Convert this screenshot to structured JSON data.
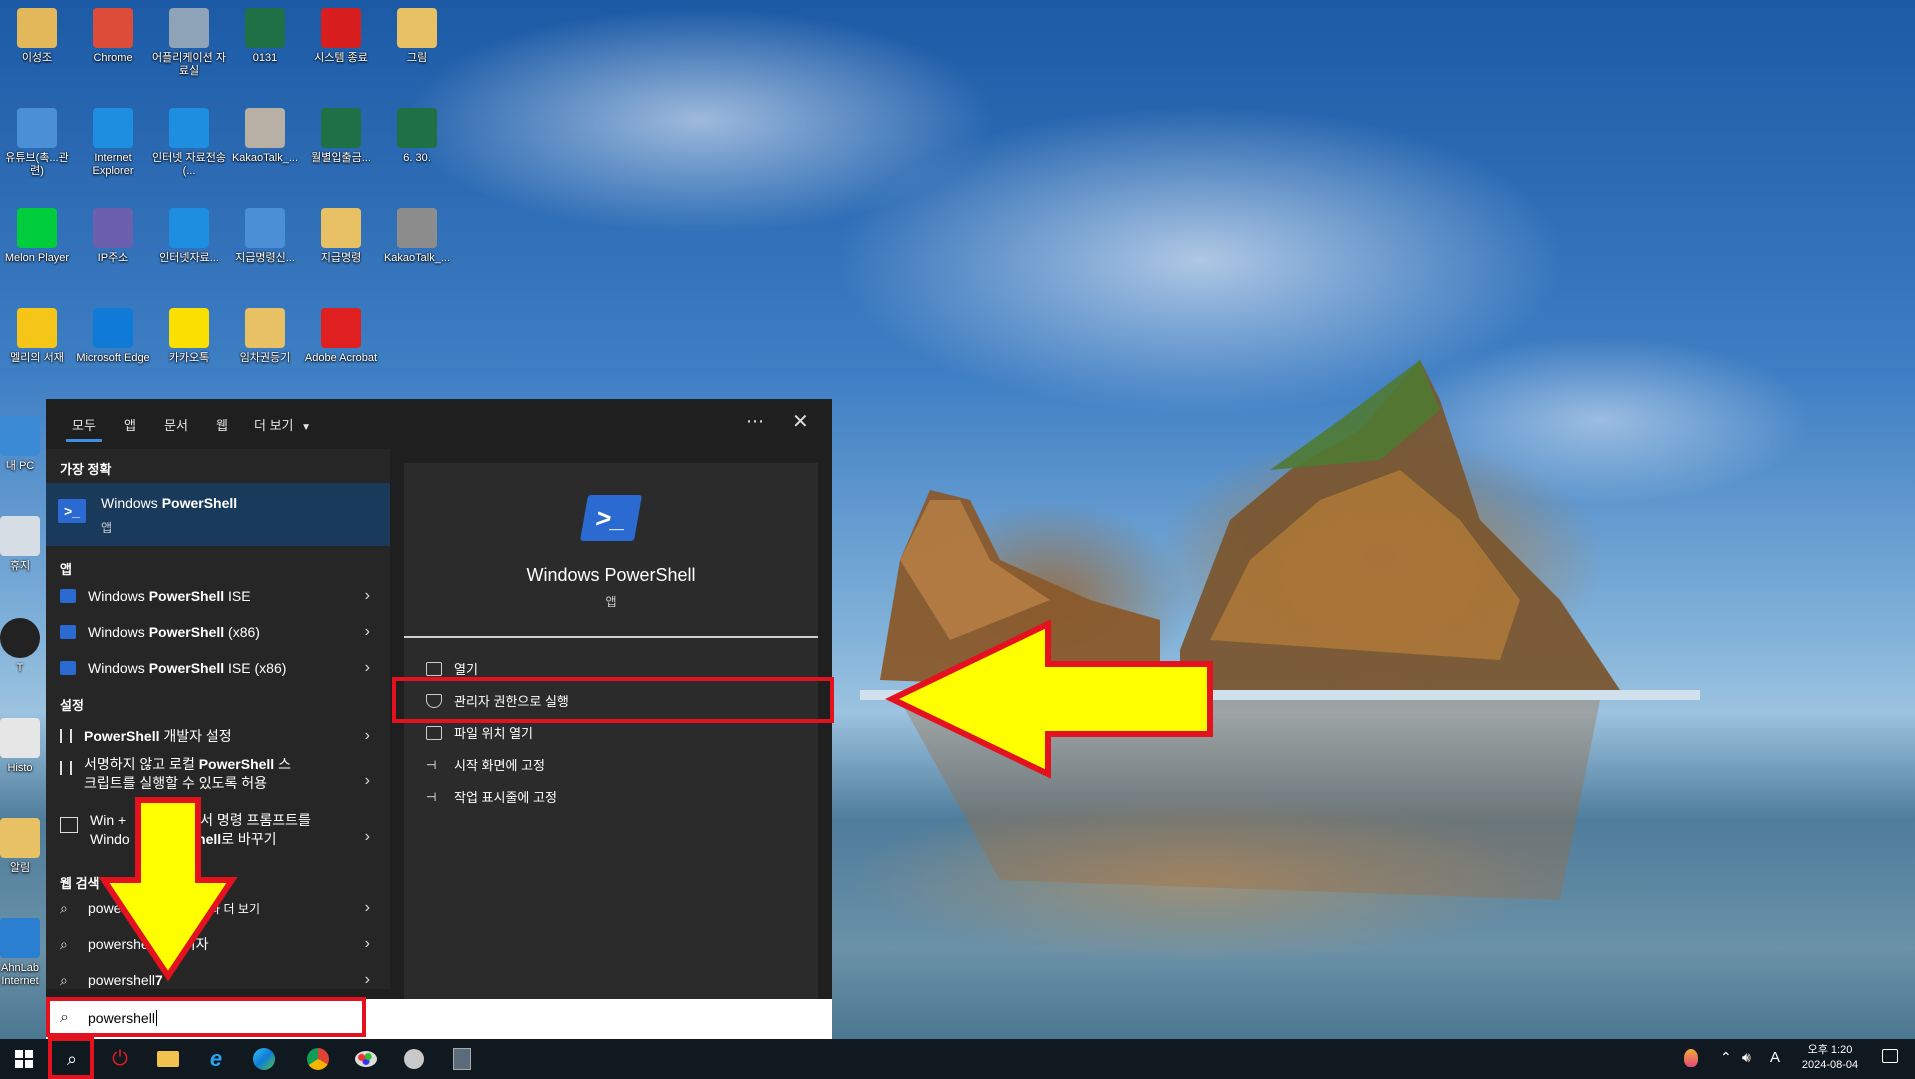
{
  "desktop_icons": [
    {
      "label": "이성조",
      "icon": "user-folder-icon",
      "color": "#e2b85a"
    },
    {
      "label": "Chrome",
      "icon": "chrome-icon",
      "color": "#dd4b39"
    },
    {
      "label": "어플리케이션 자료실",
      "icon": "apps-folder-icon",
      "color": "#8fa3b8"
    },
    {
      "label": "0131",
      "icon": "excel-icon",
      "color": "#1e7145"
    },
    {
      "label": "시스템 종료",
      "icon": "power-icon",
      "color": "#d81e1e"
    },
    {
      "label": "그림",
      "icon": "folder-icon",
      "color": "#e8c164"
    },
    {
      "label": "유튜브(촉...관련)",
      "icon": "hwp-doc-icon",
      "color": "#4b8fd6"
    },
    {
      "label": "Internet Explorer",
      "icon": "ie-icon",
      "color": "#1d8ee0"
    },
    {
      "label": "인터넷 자료전송(...",
      "icon": "ie-transfer-icon",
      "color": "#1d8ee0"
    },
    {
      "label": "KakaoTalk_...",
      "icon": "image-icon",
      "color": "#b9b0a5"
    },
    {
      "label": "월별입출금...",
      "icon": "excel-icon",
      "color": "#1e7145"
    },
    {
      "label": "6. 30.",
      "icon": "excel-icon",
      "color": "#1e7145"
    },
    {
      "label": "Melon Player",
      "icon": "melon-icon",
      "color": "#00cd3c"
    },
    {
      "label": "IP주소",
      "icon": "network-icon",
      "color": "#6b5fae"
    },
    {
      "label": "인터넷자료...",
      "icon": "ie-folder-icon",
      "color": "#1d8ee0"
    },
    {
      "label": "지급명령신...",
      "icon": "hwp-doc-icon",
      "color": "#4b8fd6"
    },
    {
      "label": "지급명령",
      "icon": "folder-doc-icon",
      "color": "#e8c164"
    },
    {
      "label": "KakaoTalk_...",
      "icon": "image-icon",
      "color": "#8d8d8d"
    },
    {
      "label": "멜리의 서재",
      "icon": "millie-icon",
      "color": "#f5c518"
    },
    {
      "label": "Microsoft Edge",
      "icon": "edge-icon",
      "color": "#0f7bd6"
    },
    {
      "label": "카카오톡",
      "icon": "kakaotalk-icon",
      "color": "#f9e000"
    },
    {
      "label": "임차권등기",
      "icon": "pdf-folder-icon",
      "color": "#e8c164"
    },
    {
      "label": "Adobe Acrobat",
      "icon": "acrobat-icon",
      "color": "#e02020"
    }
  ],
  "left_edge_labels": [
    "내 PC",
    "휴지",
    "T",
    "Histo",
    "알림",
    "AhnLab Internet"
  ],
  "search_panel": {
    "tabs": [
      "모두",
      "앱",
      "문서",
      "웹",
      "더 보기"
    ],
    "more_icon": "ellipsis-icon",
    "close_icon": "close-icon",
    "best_match_header": "가장 정확",
    "best_match": {
      "name_prefix": "Windows ",
      "name_bold": "PowerShell",
      "type": "앱"
    },
    "apps_header": "앱",
    "apps": [
      {
        "prefix": "Windows ",
        "bold": "PowerShell",
        "suffix": " ISE"
      },
      {
        "prefix": "Windows ",
        "bold": "PowerShell",
        "suffix": " (x86)"
      },
      {
        "prefix": "Windows ",
        "bold": "PowerShell",
        "suffix": " ISE (x86)"
      }
    ],
    "settings_header": "설정",
    "settings": [
      {
        "line1_bold": "PowerShell",
        "line1": " 개발자 설정",
        "line2": ""
      },
      {
        "line1": "서명하지 않고 로컬 ",
        "line1_bold": "PowerShell",
        "line1_after": " 스",
        "line2": "크립트를 실행할 수 있도록 허용"
      },
      {
        "line1": "Win + ",
        "line1_after": "서 명령 프롬프트를",
        "line2": "Windo",
        "line2_bold": "Shell",
        "line2_after": "로 바꾸기"
      }
    ],
    "web_header": "웹 검색",
    "web": [
      {
        "text": "power",
        "suffix": "결과 더 보기"
      },
      {
        "text": "powershe",
        "suffix": "리자"
      },
      {
        "text": "powershell ",
        "suffix": "7"
      }
    ],
    "detail": {
      "title": "Windows PowerShell",
      "type": "앱",
      "actions": [
        {
          "label": "열기",
          "icon": "open-icon"
        },
        {
          "label": "관리자 권한으로 실행",
          "icon": "admin-shield-icon"
        },
        {
          "label": "파일 위치 열기",
          "icon": "file-location-icon"
        },
        {
          "label": "시작 화면에 고정",
          "icon": "pin-icon"
        },
        {
          "label": "작업 표시줄에 고정",
          "icon": "pin-icon"
        }
      ]
    },
    "search_value": "powershell"
  },
  "taskbar": {
    "items": [
      {
        "icon": "windows-start-icon"
      },
      {
        "icon": "search-icon"
      },
      {
        "icon": "power-icon"
      },
      {
        "icon": "file-explorer-icon"
      },
      {
        "icon": "ie-icon"
      },
      {
        "icon": "edge-icon"
      },
      {
        "icon": "chrome-icon"
      },
      {
        "icon": "paint-icon"
      },
      {
        "icon": "settings-tool-icon"
      },
      {
        "icon": "calculator-icon"
      }
    ],
    "tray": {
      "ime": "A",
      "time": "오후 1:20",
      "date": "2024-08-04"
    }
  },
  "colors": {
    "highlight_red": "#e3121e",
    "arrow_yellow": "#ffff00",
    "accent_blue": "#3f8de0"
  }
}
